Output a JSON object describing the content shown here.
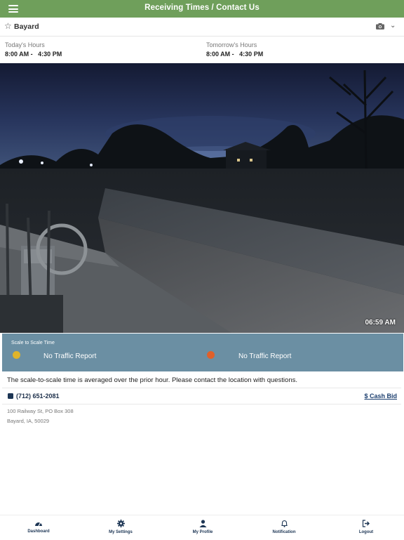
{
  "header": {
    "title": "Receiving Times / Contact Us"
  },
  "location": {
    "name": "Bayard"
  },
  "hours": {
    "today_label": "Today's Hours",
    "today_value": "8:00 AM -   4:30 PM",
    "tomorrow_label": "Tomorrow's Hours",
    "tomorrow_value": "8:00 AM -   4:30 PM"
  },
  "camera": {
    "timestamp": "06:59 AM"
  },
  "scale_panel": {
    "title": "Scale to Scale Time",
    "left_text": "No Traffic Report",
    "right_text": "No Traffic Report",
    "left_dot_color": "#e0b42a",
    "right_dot_color": "#e0602a"
  },
  "notice": "The scale-to-scale time is averaged over the prior hour. Please contact the location with questions.",
  "contact": {
    "phone": "(712) 651-2081",
    "cash_bid_label": "$ Cash Bid",
    "address_line1": "100 Railway St, PO Box 308",
    "address_line2": "Bayard, IA, 50029"
  },
  "nav": {
    "items": [
      {
        "label": "Dashboard",
        "icon": "dashboard-icon"
      },
      {
        "label": "My Settings",
        "icon": "gear-icon"
      },
      {
        "label": "My Profile",
        "icon": "person-icon"
      },
      {
        "label": "Notification",
        "icon": "bell-icon"
      },
      {
        "label": "Logout",
        "icon": "logout-icon"
      }
    ]
  },
  "colors": {
    "header": "#6f9f5b",
    "panel": "#6b8fa3",
    "nav_text": "#1c3554"
  }
}
